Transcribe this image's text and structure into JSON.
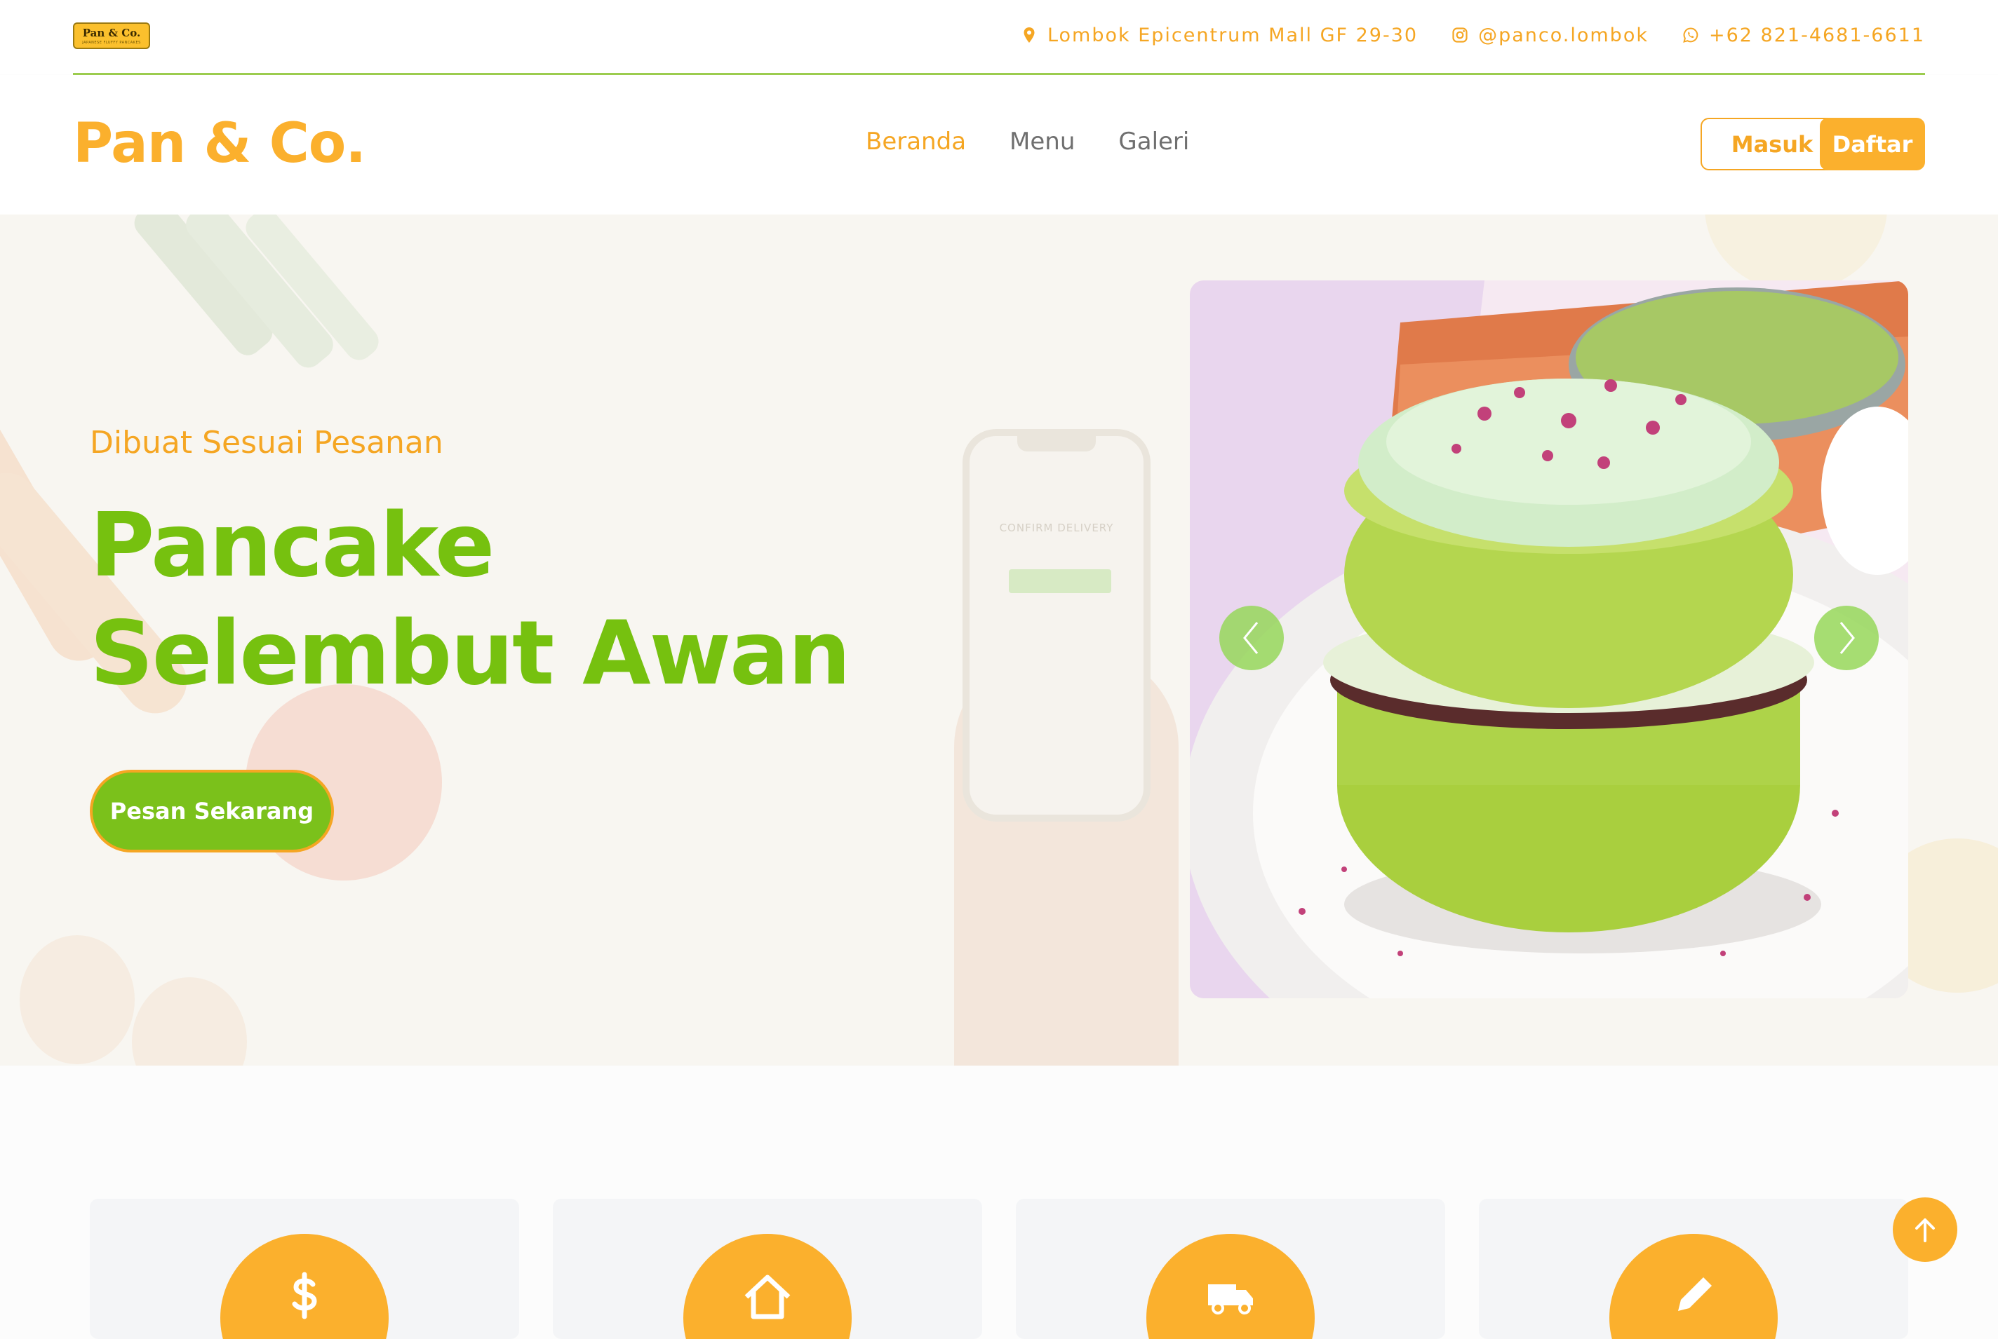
{
  "topbar": {
    "logo_text": "Pan & Co.",
    "logo_tagline": "JAPANESE FLUFFY PANCAKES",
    "address": "Lombok Epicentrum Mall GF 29-30",
    "instagram": "@panco.lombok",
    "whatsapp": "+62 821-4681-6611",
    "icons": [
      "map-marker-icon",
      "instagram-icon",
      "whatsapp-icon"
    ]
  },
  "navbar": {
    "brand": "Pan & Co.",
    "links": [
      "Beranda",
      "Menu",
      "Galeri"
    ],
    "active_link": "Beranda",
    "login_label": "Masuk",
    "register_label": "Daftar"
  },
  "hero": {
    "subtitle": "Dibuat Sesuai Pesanan",
    "title_line1": "Pancake",
    "title_line2": "Selembut Awan",
    "cta_label": "Pesan Sekarang",
    "phone_screen_text": "CONFIRM DELIVERY",
    "carousel": {
      "prev_icon": "chevron-left-icon",
      "next_icon": "chevron-right-icon"
    }
  },
  "features": {
    "icons": [
      "dollar-icon",
      "home-icon",
      "truck-icon",
      "pencil-icon"
    ]
  },
  "back_to_top_icon": "arrow-up-icon",
  "colors": {
    "primary_orange": "#fbb02d",
    "primary_green": "#76c10f",
    "divider_green": "#9ccc4f",
    "hero_bg": "#f8f6f1"
  }
}
